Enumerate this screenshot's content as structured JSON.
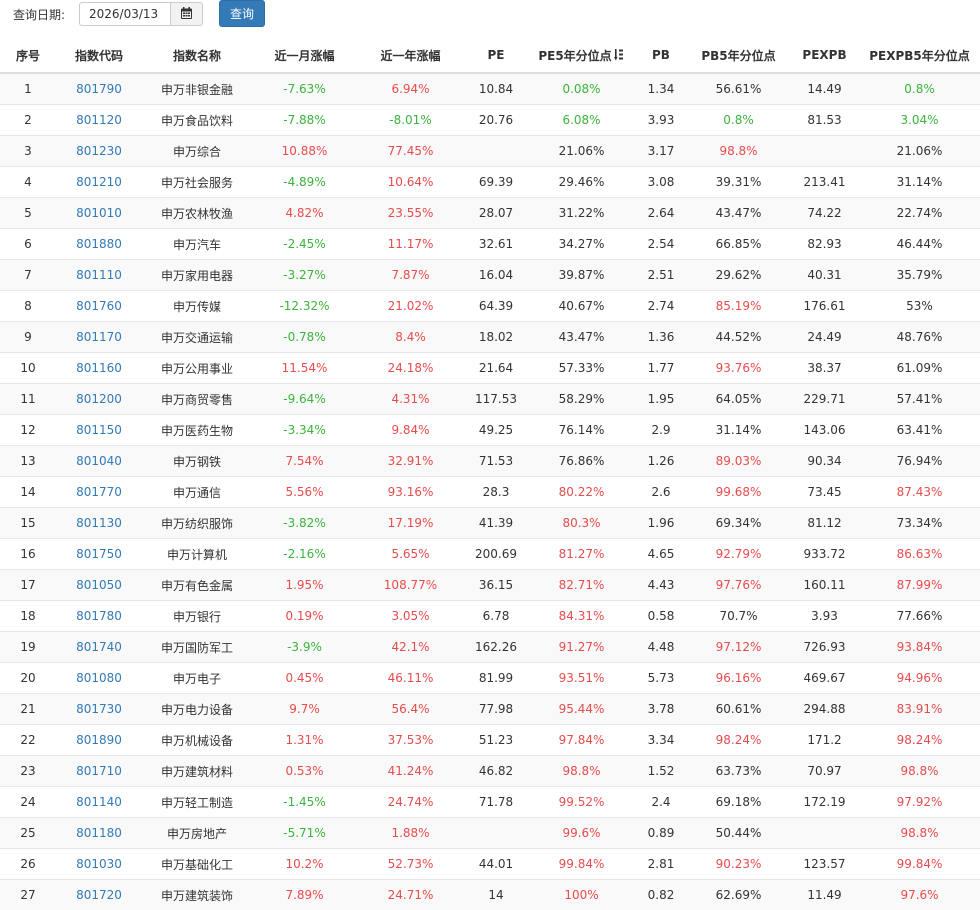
{
  "toolbar": {
    "date_label": "查询日期:",
    "date_value": "2026/03/13",
    "calendar_icon": "calendar-icon",
    "query_label": "查询"
  },
  "columns": [
    "序号",
    "指数代码",
    "指数名称",
    "近一月涨幅",
    "近一年涨幅",
    "PE",
    "PE5年分位点",
    "PB",
    "PB5年分位点",
    "PEXPB",
    "PEXPB5年分位点"
  ],
  "sort_icon": "sort-numeric-icon",
  "colors": {
    "up": "#e74c4c",
    "down": "#3bb43b",
    "link": "#337ab7",
    "button": "#337ab7"
  },
  "rows": [
    {
      "no": "1",
      "code": "801790",
      "name": "申万非银金融",
      "m1": "-7.63%",
      "m1c": "down",
      "y1": "6.94%",
      "y1c": "up",
      "pe": "10.84",
      "pe5": "0.08%",
      "pe5c": "down",
      "pb": "1.34",
      "pb5": "56.61%",
      "pb5c": "",
      "pexpb": "14.49",
      "pexpb5": "0.8%",
      "pexpb5c": "down"
    },
    {
      "no": "2",
      "code": "801120",
      "name": "申万食品饮料",
      "m1": "-7.88%",
      "m1c": "down",
      "y1": "-8.01%",
      "y1c": "down",
      "pe": "20.76",
      "pe5": "6.08%",
      "pe5c": "down",
      "pb": "3.93",
      "pb5": "0.8%",
      "pb5c": "down",
      "pexpb": "81.53",
      "pexpb5": "3.04%",
      "pexpb5c": "down"
    },
    {
      "no": "3",
      "code": "801230",
      "name": "申万综合",
      "m1": "10.88%",
      "m1c": "up",
      "y1": "77.45%",
      "y1c": "up",
      "pe": "",
      "pe5": "21.06%",
      "pe5c": "",
      "pb": "3.17",
      "pb5": "98.8%",
      "pb5c": "up",
      "pexpb": "",
      "pexpb5": "21.06%",
      "pexpb5c": ""
    },
    {
      "no": "4",
      "code": "801210",
      "name": "申万社会服务",
      "m1": "-4.89%",
      "m1c": "down",
      "y1": "10.64%",
      "y1c": "up",
      "pe": "69.39",
      "pe5": "29.46%",
      "pe5c": "",
      "pb": "3.08",
      "pb5": "39.31%",
      "pb5c": "",
      "pexpb": "213.41",
      "pexpb5": "31.14%",
      "pexpb5c": ""
    },
    {
      "no": "5",
      "code": "801010",
      "name": "申万农林牧渔",
      "m1": "4.82%",
      "m1c": "up",
      "y1": "23.55%",
      "y1c": "up",
      "pe": "28.07",
      "pe5": "31.22%",
      "pe5c": "",
      "pb": "2.64",
      "pb5": "43.47%",
      "pb5c": "",
      "pexpb": "74.22",
      "pexpb5": "22.74%",
      "pexpb5c": ""
    },
    {
      "no": "6",
      "code": "801880",
      "name": "申万汽车",
      "m1": "-2.45%",
      "m1c": "down",
      "y1": "11.17%",
      "y1c": "up",
      "pe": "32.61",
      "pe5": "34.27%",
      "pe5c": "",
      "pb": "2.54",
      "pb5": "66.85%",
      "pb5c": "",
      "pexpb": "82.93",
      "pexpb5": "46.44%",
      "pexpb5c": ""
    },
    {
      "no": "7",
      "code": "801110",
      "name": "申万家用电器",
      "m1": "-3.27%",
      "m1c": "down",
      "y1": "7.87%",
      "y1c": "up",
      "pe": "16.04",
      "pe5": "39.87%",
      "pe5c": "",
      "pb": "2.51",
      "pb5": "29.62%",
      "pb5c": "",
      "pexpb": "40.31",
      "pexpb5": "35.79%",
      "pexpb5c": ""
    },
    {
      "no": "8",
      "code": "801760",
      "name": "申万传媒",
      "m1": "-12.32%",
      "m1c": "down",
      "y1": "21.02%",
      "y1c": "up",
      "pe": "64.39",
      "pe5": "40.67%",
      "pe5c": "",
      "pb": "2.74",
      "pb5": "85.19%",
      "pb5c": "up",
      "pexpb": "176.61",
      "pexpb5": "53%",
      "pexpb5c": ""
    },
    {
      "no": "9",
      "code": "801170",
      "name": "申万交通运输",
      "m1": "-0.78%",
      "m1c": "down",
      "y1": "8.4%",
      "y1c": "up",
      "pe": "18.02",
      "pe5": "43.47%",
      "pe5c": "",
      "pb": "1.36",
      "pb5": "44.52%",
      "pb5c": "",
      "pexpb": "24.49",
      "pexpb5": "48.76%",
      "pexpb5c": ""
    },
    {
      "no": "10",
      "code": "801160",
      "name": "申万公用事业",
      "m1": "11.54%",
      "m1c": "up",
      "y1": "24.18%",
      "y1c": "up",
      "pe": "21.64",
      "pe5": "57.33%",
      "pe5c": "",
      "pb": "1.77",
      "pb5": "93.76%",
      "pb5c": "up",
      "pexpb": "38.37",
      "pexpb5": "61.09%",
      "pexpb5c": ""
    },
    {
      "no": "11",
      "code": "801200",
      "name": "申万商贸零售",
      "m1": "-9.64%",
      "m1c": "down",
      "y1": "4.31%",
      "y1c": "up",
      "pe": "117.53",
      "pe5": "58.29%",
      "pe5c": "",
      "pb": "1.95",
      "pb5": "64.05%",
      "pb5c": "",
      "pexpb": "229.71",
      "pexpb5": "57.41%",
      "pexpb5c": ""
    },
    {
      "no": "12",
      "code": "801150",
      "name": "申万医药生物",
      "m1": "-3.34%",
      "m1c": "down",
      "y1": "9.84%",
      "y1c": "up",
      "pe": "49.25",
      "pe5": "76.14%",
      "pe5c": "",
      "pb": "2.9",
      "pb5": "31.14%",
      "pb5c": "",
      "pexpb": "143.06",
      "pexpb5": "63.41%",
      "pexpb5c": ""
    },
    {
      "no": "13",
      "code": "801040",
      "name": "申万钢铁",
      "m1": "7.54%",
      "m1c": "up",
      "y1": "32.91%",
      "y1c": "up",
      "pe": "71.53",
      "pe5": "76.86%",
      "pe5c": "",
      "pb": "1.26",
      "pb5": "89.03%",
      "pb5c": "up",
      "pexpb": "90.34",
      "pexpb5": "76.94%",
      "pexpb5c": ""
    },
    {
      "no": "14",
      "code": "801770",
      "name": "申万通信",
      "m1": "5.56%",
      "m1c": "up",
      "y1": "93.16%",
      "y1c": "up",
      "pe": "28.3",
      "pe5": "80.22%",
      "pe5c": "up",
      "pb": "2.6",
      "pb5": "99.68%",
      "pb5c": "up",
      "pexpb": "73.45",
      "pexpb5": "87.43%",
      "pexpb5c": "up"
    },
    {
      "no": "15",
      "code": "801130",
      "name": "申万纺织服饰",
      "m1": "-3.82%",
      "m1c": "down",
      "y1": "17.19%",
      "y1c": "up",
      "pe": "41.39",
      "pe5": "80.3%",
      "pe5c": "up",
      "pb": "1.96",
      "pb5": "69.34%",
      "pb5c": "",
      "pexpb": "81.12",
      "pexpb5": "73.34%",
      "pexpb5c": ""
    },
    {
      "no": "16",
      "code": "801750",
      "name": "申万计算机",
      "m1": "-2.16%",
      "m1c": "down",
      "y1": "5.65%",
      "y1c": "up",
      "pe": "200.69",
      "pe5": "81.27%",
      "pe5c": "up",
      "pb": "4.65",
      "pb5": "92.79%",
      "pb5c": "up",
      "pexpb": "933.72",
      "pexpb5": "86.63%",
      "pexpb5c": "up"
    },
    {
      "no": "17",
      "code": "801050",
      "name": "申万有色金属",
      "m1": "1.95%",
      "m1c": "up",
      "y1": "108.77%",
      "y1c": "up",
      "pe": "36.15",
      "pe5": "82.71%",
      "pe5c": "up",
      "pb": "4.43",
      "pb5": "97.76%",
      "pb5c": "up",
      "pexpb": "160.11",
      "pexpb5": "87.99%",
      "pexpb5c": "up"
    },
    {
      "no": "18",
      "code": "801780",
      "name": "申万银行",
      "m1": "0.19%",
      "m1c": "up",
      "y1": "3.05%",
      "y1c": "up",
      "pe": "6.78",
      "pe5": "84.31%",
      "pe5c": "up",
      "pb": "0.58",
      "pb5": "70.7%",
      "pb5c": "",
      "pexpb": "3.93",
      "pexpb5": "77.66%",
      "pexpb5c": ""
    },
    {
      "no": "19",
      "code": "801740",
      "name": "申万国防军工",
      "m1": "-3.9%",
      "m1c": "down",
      "y1": "42.1%",
      "y1c": "up",
      "pe": "162.26",
      "pe5": "91.27%",
      "pe5c": "up",
      "pb": "4.48",
      "pb5": "97.12%",
      "pb5c": "up",
      "pexpb": "726.93",
      "pexpb5": "93.84%",
      "pexpb5c": "up"
    },
    {
      "no": "20",
      "code": "801080",
      "name": "申万电子",
      "m1": "0.45%",
      "m1c": "up",
      "y1": "46.11%",
      "y1c": "up",
      "pe": "81.99",
      "pe5": "93.51%",
      "pe5c": "up",
      "pb": "5.73",
      "pb5": "96.16%",
      "pb5c": "up",
      "pexpb": "469.67",
      "pexpb5": "94.96%",
      "pexpb5c": "up"
    },
    {
      "no": "21",
      "code": "801730",
      "name": "申万电力设备",
      "m1": "9.7%",
      "m1c": "up",
      "y1": "56.4%",
      "y1c": "up",
      "pe": "77.98",
      "pe5": "95.44%",
      "pe5c": "up",
      "pb": "3.78",
      "pb5": "60.61%",
      "pb5c": "",
      "pexpb": "294.88",
      "pexpb5": "83.91%",
      "pexpb5c": "up"
    },
    {
      "no": "22",
      "code": "801890",
      "name": "申万机械设备",
      "m1": "1.31%",
      "m1c": "up",
      "y1": "37.53%",
      "y1c": "up",
      "pe": "51.23",
      "pe5": "97.84%",
      "pe5c": "up",
      "pb": "3.34",
      "pb5": "98.24%",
      "pb5c": "up",
      "pexpb": "171.2",
      "pexpb5": "98.24%",
      "pexpb5c": "up"
    },
    {
      "no": "23",
      "code": "801710",
      "name": "申万建筑材料",
      "m1": "0.53%",
      "m1c": "up",
      "y1": "41.24%",
      "y1c": "up",
      "pe": "46.82",
      "pe5": "98.8%",
      "pe5c": "up",
      "pb": "1.52",
      "pb5": "63.73%",
      "pb5c": "",
      "pexpb": "70.97",
      "pexpb5": "98.8%",
      "pexpb5c": "up"
    },
    {
      "no": "24",
      "code": "801140",
      "name": "申万轻工制造",
      "m1": "-1.45%",
      "m1c": "down",
      "y1": "24.74%",
      "y1c": "up",
      "pe": "71.78",
      "pe5": "99.52%",
      "pe5c": "up",
      "pb": "2.4",
      "pb5": "69.18%",
      "pb5c": "",
      "pexpb": "172.19",
      "pexpb5": "97.92%",
      "pexpb5c": "up"
    },
    {
      "no": "25",
      "code": "801180",
      "name": "申万房地产",
      "m1": "-5.71%",
      "m1c": "down",
      "y1": "1.88%",
      "y1c": "up",
      "pe": "",
      "pe5": "99.6%",
      "pe5c": "up",
      "pb": "0.89",
      "pb5": "50.44%",
      "pb5c": "",
      "pexpb": "",
      "pexpb5": "98.8%",
      "pexpb5c": "up"
    },
    {
      "no": "26",
      "code": "801030",
      "name": "申万基础化工",
      "m1": "10.2%",
      "m1c": "up",
      "y1": "52.73%",
      "y1c": "up",
      "pe": "44.01",
      "pe5": "99.84%",
      "pe5c": "up",
      "pb": "2.81",
      "pb5": "90.23%",
      "pb5c": "up",
      "pexpb": "123.57",
      "pexpb5": "99.84%",
      "pexpb5c": "up"
    },
    {
      "no": "27",
      "code": "801720",
      "name": "申万建筑装饰",
      "m1": "7.89%",
      "m1c": "up",
      "y1": "24.71%",
      "y1c": "up",
      "pe": "14",
      "pe5": "100%",
      "pe5c": "up",
      "pb": "0.82",
      "pb5": "62.69%",
      "pb5c": "",
      "pexpb": "11.49",
      "pexpb5": "97.6%",
      "pexpb5c": "up"
    }
  ]
}
